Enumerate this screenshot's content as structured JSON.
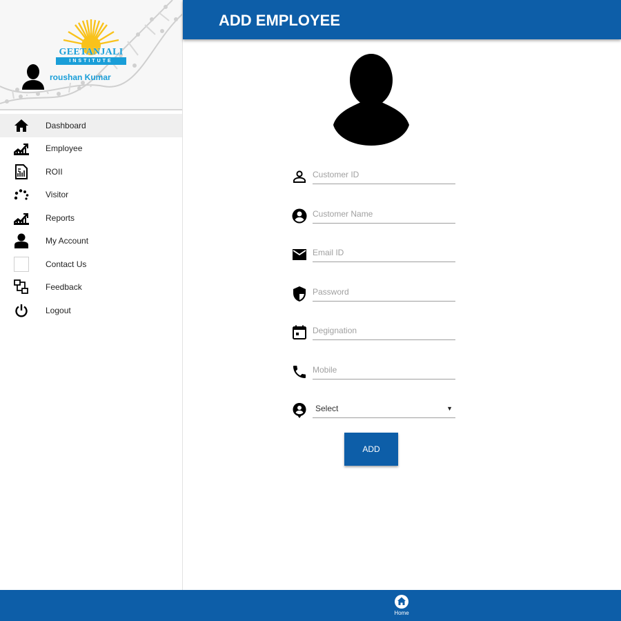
{
  "header": {
    "title": "ADD EMPLOYEE"
  },
  "brand": {
    "name": "GEETANJALI",
    "subtitle": "INSTITUTE"
  },
  "user": {
    "name": "roushan Kumar"
  },
  "sidebar": {
    "items": [
      {
        "label": "Dashboard",
        "icon": "home-icon",
        "active": true
      },
      {
        "label": "Employee",
        "icon": "trending-chart-icon"
      },
      {
        "label": "ROII",
        "icon": "document-chart-icon"
      },
      {
        "label": "Visitor",
        "icon": "dotted-loader-icon"
      },
      {
        "label": "Reports",
        "icon": "trending-chart-icon"
      },
      {
        "label": "My Account",
        "icon": "person-icon"
      },
      {
        "label": "Contact Us",
        "icon": "blank-square-icon"
      },
      {
        "label": "Feedback",
        "icon": "flow-icon"
      },
      {
        "label": "Logout",
        "icon": "power-icon"
      }
    ]
  },
  "form": {
    "customer_id": {
      "placeholder": "Customer ID",
      "icon": "person-outline-icon"
    },
    "customer_name": {
      "placeholder": "Customer Name",
      "icon": "account-circle-icon"
    },
    "email": {
      "placeholder": "Email ID",
      "icon": "mail-icon"
    },
    "password": {
      "placeholder": "Password",
      "icon": "shield-icon"
    },
    "designation": {
      "placeholder": "Degignation",
      "icon": "calendar-icon"
    },
    "mobile": {
      "placeholder": "Mobile",
      "icon": "phone-icon"
    },
    "role": {
      "value": "Select",
      "icon": "person-pin-icon"
    },
    "submit_label": "ADD"
  },
  "footer": {
    "home_label": "Home"
  },
  "colors": {
    "primary": "#0d5ea8",
    "accent": "#1a9ed8",
    "logo_sun": "#f9c21b"
  }
}
